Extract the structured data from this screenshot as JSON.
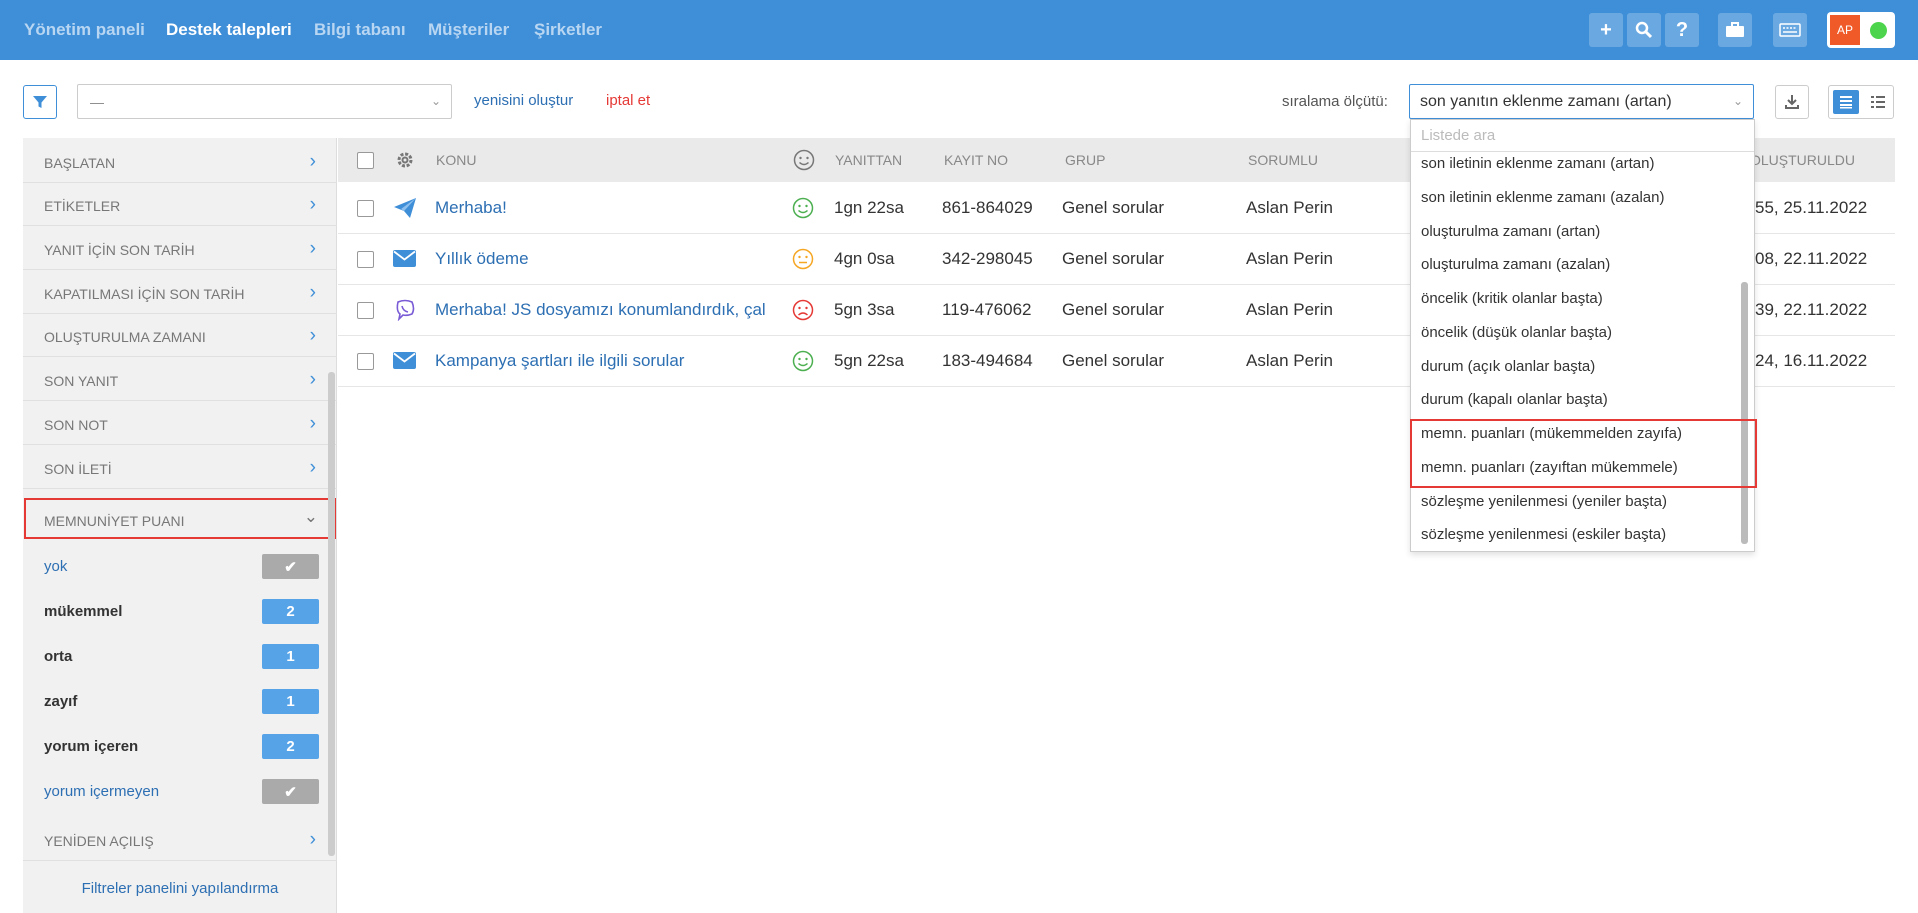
{
  "nav": {
    "links": [
      "Yönetim paneli",
      "Destek talepleri",
      "Bilgi tabanı",
      "Müşteriler",
      "Şirketler"
    ],
    "user_initials": "AP"
  },
  "toolbar": {
    "filter_value": "—",
    "create_new": "yenisini oluştur",
    "cancel": "iptal et",
    "sort_label": "sıralama ölçütü:",
    "sort_value": "son yanıtın eklenme zamanı (artan)"
  },
  "sidebar": {
    "items": [
      "BAŞLATAN",
      "ETİKETLER",
      "YANIT İÇİN SON TARİH",
      "KAPATILMASI İÇİN SON TARİH",
      "OLUŞTURULMA ZAMANI",
      "SON YANIT",
      "SON NOT",
      "SON İLETİ"
    ],
    "satisfaction_header": "MEMNUNİYET PUANI",
    "satisfaction_options": [
      {
        "label": "yok",
        "badge": "✔"
      },
      {
        "label": "mükemmel",
        "badge": "2"
      },
      {
        "label": "orta",
        "badge": "1"
      },
      {
        "label": "zayıf",
        "badge": "1"
      },
      {
        "label": "yorum içeren",
        "badge": "2"
      },
      {
        "label": "yorum içermeyen",
        "badge": "✔"
      }
    ],
    "reopen": "YENİDEN AÇILIŞ",
    "configure": "Filtreler panelini yapılandırma"
  },
  "table": {
    "headers": {
      "subject": "KONU",
      "response": "YANITTAN",
      "record": "KAYIT NO",
      "group": "GRUP",
      "owner": "SORUMLU",
      "created": "OLUŞTURULDU"
    },
    "rows": [
      {
        "subject": "Merhaba!",
        "response": "1gn 22sa",
        "record": "861-864029",
        "group": "Genel sorular",
        "owner": "Aslan Perin",
        "created": "55, 25.11.2022",
        "channel_icon": "telegram-icon",
        "mood": "happy"
      },
      {
        "subject": "Yıllık ödeme",
        "response": "4gn 0sa",
        "record": "342-298045",
        "group": "Genel sorular",
        "owner": "Aslan Perin",
        "created": "08, 22.11.2022",
        "channel_icon": "email-icon",
        "mood": "neutral"
      },
      {
        "subject": "Merhaba! JS dosyamızı konumlandırdık, çal",
        "response": "5gn 3sa",
        "record": "119-476062",
        "group": "Genel sorular",
        "owner": "Aslan Perin",
        "created": "39, 22.11.2022",
        "channel_icon": "viber-icon",
        "mood": "sad"
      },
      {
        "subject": "Kampanya şartları ile ilgili sorular",
        "response": "5gn 22sa",
        "record": "183-494684",
        "group": "Genel sorular",
        "owner": "Aslan Perin",
        "created": "24, 16.11.2022",
        "channel_icon": "email-icon",
        "mood": "happy"
      }
    ]
  },
  "dropdown": {
    "search_placeholder": "Listede ara",
    "options": [
      "son iletinin eklenme zamanı (artan)",
      "son iletinin eklenme zamanı (azalan)",
      "oluşturulma zamanı (artan)",
      "oluşturulma zamanı (azalan)",
      "öncelik (kritik olanlar başta)",
      "öncelik (düşük olanlar başta)",
      "durum (açık olanlar başta)",
      "durum (kapalı olanlar başta)",
      "memn. puanları (mükemmelden zayıfa)",
      "memn. puanları (zayıftan mükemmele)",
      "sözleşme yenilenmesi (yeniler başta)",
      "sözleşme yenilenmesi (eskiler başta)"
    ]
  },
  "colors": {
    "nav_bg": "#3f8fd8",
    "accent": "#3f8fd8",
    "link": "#2d6fb3",
    "cancel": "#e53935",
    "highlight": "#e53935",
    "happy": "#4caf50",
    "neutral": "#f5a623",
    "sad": "#e53935"
  }
}
